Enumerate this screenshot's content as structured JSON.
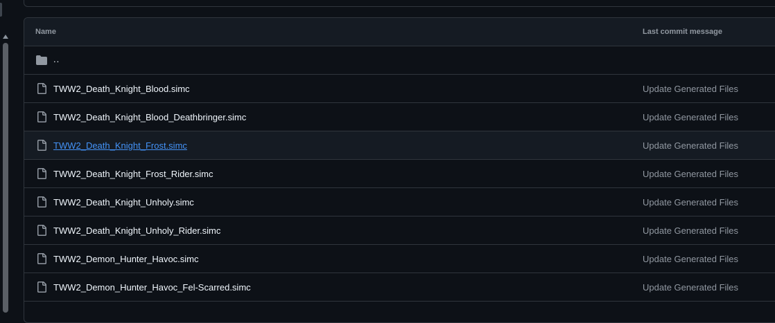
{
  "table": {
    "headers": {
      "name": "Name",
      "commit": "Last commit message"
    },
    "parent_dir": {
      "label": "..",
      "icon": "folder-icon"
    },
    "files": [
      {
        "name": "TWW2_Death_Knight_Blood.simc",
        "commit": "Update Generated Files",
        "icon": "file-icon"
      },
      {
        "name": "TWW2_Death_Knight_Blood_Deathbringer.simc",
        "commit": "Update Generated Files",
        "icon": "file-icon"
      },
      {
        "name": "TWW2_Death_Knight_Frost.simc",
        "commit": "Update Generated Files",
        "icon": "file-icon",
        "hovered": true
      },
      {
        "name": "TWW2_Death_Knight_Frost_Rider.simc",
        "commit": "Update Generated Files",
        "icon": "file-icon"
      },
      {
        "name": "TWW2_Death_Knight_Unholy.simc",
        "commit": "Update Generated Files",
        "icon": "file-icon"
      },
      {
        "name": "TWW2_Death_Knight_Unholy_Rider.simc",
        "commit": "Update Generated Files",
        "icon": "file-icon"
      },
      {
        "name": "TWW2_Demon_Hunter_Havoc.simc",
        "commit": "Update Generated Files",
        "icon": "file-icon"
      },
      {
        "name": "TWW2_Demon_Hunter_Havoc_Fel-Scarred.simc",
        "commit": "Update Generated Files",
        "icon": "file-icon"
      }
    ]
  },
  "colors": {
    "background": "#0d1117",
    "header_bg": "#151b23",
    "border": "#30363d",
    "text_primary": "#f0f6fc",
    "text_muted": "#9198a1",
    "link": "#4493f8",
    "icon": "#9198a1"
  }
}
